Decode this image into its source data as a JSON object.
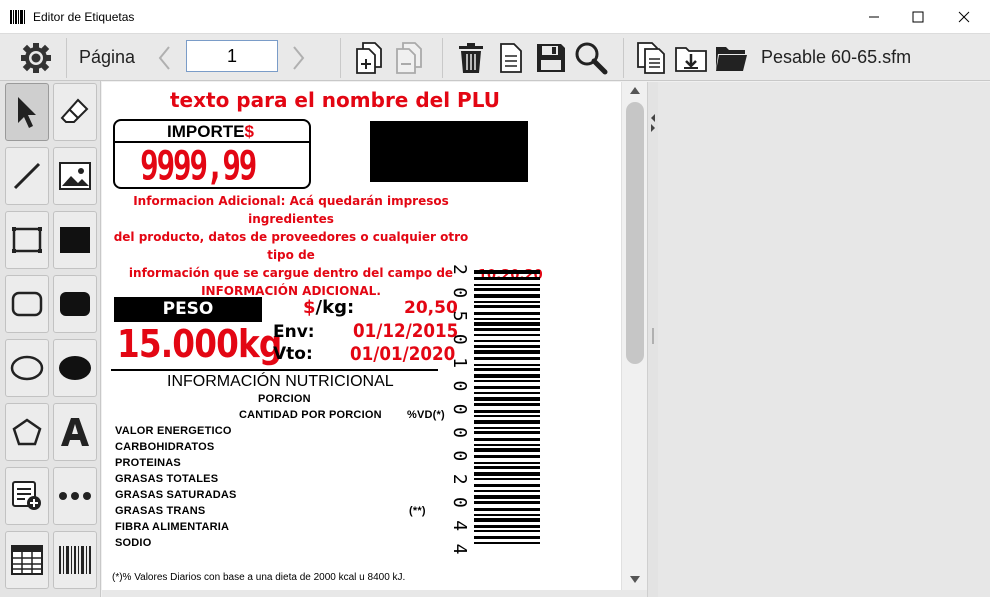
{
  "window": {
    "title": "Editor de Etiquetas"
  },
  "toolbar": {
    "page_label": "Página",
    "page_value": "1",
    "filename": "Pesable 60-65.sfm"
  },
  "label": {
    "plu_name": "texto para el nombre del PLU",
    "importe_label": "IMPORTE",
    "importe_currency": "$",
    "importe_value": "9999,99",
    "info_lines": [
      "Informacion Adicional: Acá quedarán impresos ingredientes",
      "del producto, datos de proveedores o cualquier otro tipo de",
      "información que se cargue dentro del campo de",
      "INFORMACIÓN ADICIONAL."
    ],
    "time": "10:20:20",
    "peso_label": "PESO",
    "peso_value": "15.000kg",
    "price_currency": "$",
    "price_unit": "/kg:",
    "price_value": "20,50",
    "env_label": "Env:",
    "env_date": "01/12/2015",
    "vto_label": "Vto:",
    "vto_date": "01/01/2020",
    "barcode_digits": "2050100002044",
    "nutrition": {
      "title": "INFORMACIÓN NUTRICIONAL",
      "porcion": "PORCION",
      "cantidad": "CANTIDAD POR PORCION",
      "vd": "%VD(*)",
      "rows": [
        "VALOR ENERGETICO",
        "CARBOHIDRATOS",
        "PROTEINAS",
        "GRASAS TOTALES",
        "GRASAS SATURADAS",
        "GRASAS TRANS",
        "FIBRA ALIMENTARIA",
        "SODIO"
      ],
      "trans_note": "(**)",
      "footnote": "(*)% Valores Diarios con base a una dieta de 2000 kcal u 8400 kJ."
    }
  },
  "colors": {
    "accent_red": "#e30613",
    "toolbar_bg": "#e9e9e9"
  }
}
